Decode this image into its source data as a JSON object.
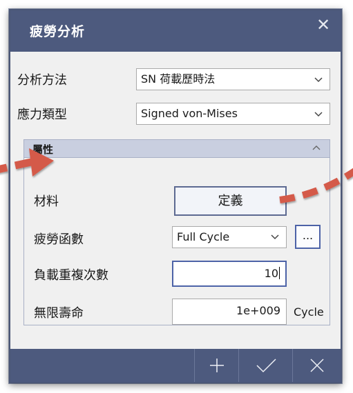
{
  "dialog": {
    "title": "疲勞分析"
  },
  "analysis_method": {
    "label": "分析方法",
    "value": "SN 荷載歷時法"
  },
  "stress_type": {
    "label": "應力類型",
    "value": "Signed von-Mises"
  },
  "properties": {
    "header": "屬性",
    "material": {
      "label": "材料",
      "button": "定義"
    },
    "fatigue_function": {
      "label": "疲勞函數",
      "value": "Full Cycle",
      "browse": "..."
    },
    "load_repeats": {
      "label": "負載重複次數",
      "value": "10"
    },
    "infinite_life": {
      "label": "無限壽命",
      "value": "1e+009",
      "unit": "Cycle"
    }
  },
  "footer": {
    "add_icon": "plus-icon",
    "confirm_icon": "check-icon",
    "cancel_icon": "close-icon"
  },
  "colors": {
    "title_bar": "#4d5a7e",
    "group_header": "#c9cfe0",
    "active_border": "#4c62a7",
    "annotation_arrow": "#d45a4a"
  }
}
